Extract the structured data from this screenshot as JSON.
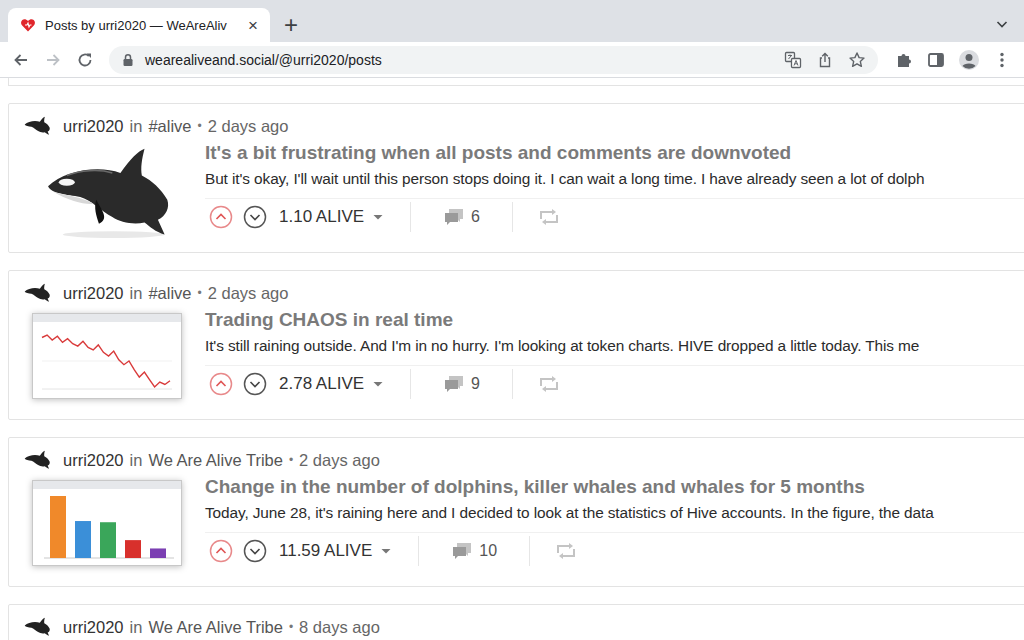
{
  "browser": {
    "tabs": [
      {
        "title": "Posts by urri2020 — WeAreAliv",
        "selected": true,
        "close": "×"
      }
    ],
    "new_tab": "+",
    "address": "wearealiveand.social/@urri2020/posts",
    "back_enabled": true,
    "forward_enabled": false
  },
  "labels": {
    "in": "in",
    "dot": "•"
  },
  "posts": [
    {
      "author": "urri2020",
      "community": "#alive",
      "time": "2 days ago",
      "title": "It's a bit frustrating when all posts and comments are downvoted",
      "excerpt": "But it's okay, I'll wait until this person stops doing it. I can wait a long time. I have already seen a lot of dolph",
      "payout": "1.10 ALIVE",
      "comments": "6",
      "thumbnail": {
        "kind": "picture"
      }
    },
    {
      "author": "urri2020",
      "community": "#alive",
      "time": "2 days ago",
      "title": "Trading CHAOS in real time",
      "excerpt": "It's still raining outside. And I'm in no hurry. I'm looking at token charts. HIVE dropped a little today. This me",
      "payout": "2.78 ALIVE",
      "comments": "9",
      "thumbnail": {
        "kind": "line-chart",
        "color": "#d93a3a",
        "values": [
          62,
          64,
          60,
          63,
          58,
          61,
          57,
          55,
          59,
          54,
          52,
          56,
          50,
          47,
          51,
          44,
          40,
          43,
          36,
          30,
          34,
          28,
          22,
          26,
          24,
          27
        ]
      }
    },
    {
      "author": "urri2020",
      "community": "We Are Alive Tribe",
      "time": "2 days ago",
      "title": "Change in the number of dolphins, killer whales and whales for 5 months",
      "excerpt": "Today, June 28, it's raining here and I decided to look at the statistics of Hive accounts. In the figure, the data",
      "payout": "11.59 ALIVE",
      "comments": "10",
      "thumbnail": {
        "kind": "bar-chart",
        "bars": [
          {
            "value": 5.2,
            "color": "#f0892a"
          },
          {
            "value": 3.1,
            "color": "#3b8fd8"
          },
          {
            "value": 3.0,
            "color": "#3aa65a"
          },
          {
            "value": 1.5,
            "color": "#d8302c"
          },
          {
            "value": 0.8,
            "color": "#7b3fb2"
          }
        ]
      }
    }
  ],
  "partial_post": {
    "author": "urri2020",
    "community": "We Are Alive Tribe",
    "time": "8 days ago"
  }
}
